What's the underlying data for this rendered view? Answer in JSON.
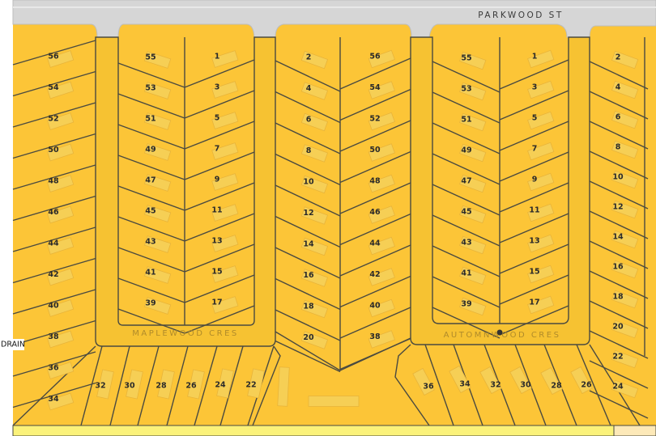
{
  "streets": {
    "parkwood": "PARKWOOD ST",
    "maplewood": "MAPLEWOOD CRES",
    "automnwood": "AUTOMNWOOD CRES",
    "drain": "DRAIN"
  },
  "colors": {
    "parcel": "#fcc537",
    "road_gray": "#d6d6d6",
    "outline": "#4a4a40",
    "bottom_strip": "#fbf27a"
  },
  "lot_columns": {
    "west_edge": [
      "56",
      "54",
      "52",
      "50",
      "48",
      "46",
      "44",
      "42",
      "40",
      "38",
      "36",
      "34"
    ],
    "maplewood_inner_left": [
      "55",
      "53",
      "51",
      "49",
      "47",
      "45",
      "43",
      "41",
      "39"
    ],
    "maplewood_inner_right": [
      "1",
      "3",
      "5",
      "7",
      "9",
      "11",
      "13",
      "15",
      "17"
    ],
    "middle_left": [
      "2",
      "4",
      "6",
      "8",
      "10",
      "12",
      "14",
      "16",
      "18",
      "20"
    ],
    "middle_right": [
      "56",
      "54",
      "52",
      "50",
      "48",
      "46",
      "44",
      "42",
      "40",
      "38"
    ],
    "automnwood_inner_left": [
      "55",
      "53",
      "51",
      "49",
      "47",
      "45",
      "43",
      "41",
      "39"
    ],
    "automnwood_inner_right": [
      "1",
      "3",
      "5",
      "7",
      "9",
      "11",
      "13",
      "15",
      "17"
    ],
    "east_edge": [
      "2",
      "4",
      "6",
      "8",
      "10",
      "12",
      "14",
      "16",
      "18",
      "20",
      "22",
      "24"
    ]
  },
  "bottom_lots": {
    "maplewood_south": [
      "32",
      "30",
      "28",
      "26",
      "24",
      "22"
    ],
    "automnwood_south": [
      "36",
      "34",
      "32",
      "30",
      "28",
      "26"
    ]
  }
}
